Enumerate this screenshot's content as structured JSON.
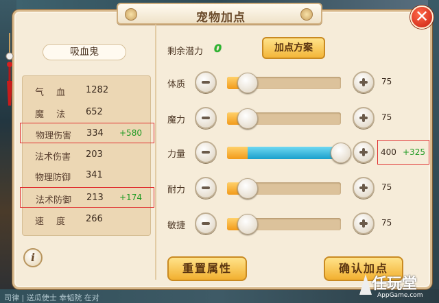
{
  "window": {
    "title": "宠物加点",
    "close_label": "✕"
  },
  "pet": {
    "name": "吸血鬼"
  },
  "stats": [
    {
      "label": "气血",
      "value": "1282",
      "bonus": "",
      "spread": true,
      "highlight": false
    },
    {
      "label": "魔法",
      "value": "652",
      "bonus": "",
      "spread": true,
      "highlight": false
    },
    {
      "label": "物理伤害",
      "value": "334",
      "bonus": "+580",
      "spread": false,
      "highlight": true
    },
    {
      "label": "法术伤害",
      "value": "203",
      "bonus": "",
      "spread": false,
      "highlight": false
    },
    {
      "label": "物理防御",
      "value": "341",
      "bonus": "",
      "spread": false,
      "highlight": false
    },
    {
      "label": "法术防御",
      "value": "213",
      "bonus": "+174",
      "spread": false,
      "highlight": true
    },
    {
      "label": "速度",
      "value": "266",
      "bonus": "",
      "spread": true,
      "highlight": false
    }
  ],
  "potential": {
    "label": "剩余潜力",
    "value": "0"
  },
  "plan_button": "加点方案",
  "attributes": [
    {
      "name": "体质",
      "value": "75",
      "extra": "",
      "fill": 0.0
    },
    {
      "name": "魔力",
      "value": "75",
      "extra": "",
      "fill": 0.0
    },
    {
      "name": "力量",
      "value": "400",
      "extra": "+325",
      "fill": 1.0
    },
    {
      "name": "耐力",
      "value": "75",
      "extra": "",
      "fill": 0.0
    },
    {
      "name": "敏捷",
      "value": "75",
      "extra": "",
      "fill": 0.0
    }
  ],
  "buttons": {
    "reset": "重置属性",
    "confirm": "确认加点"
  },
  "info_icon": "i",
  "background_text": "司律 | 送瓜使士  幸韬院  在对",
  "watermark": {
    "main": "任玩堂",
    "sub": "AppGame.com"
  },
  "colors": {
    "accent_green": "#1f9a22",
    "highlight_red": "#e03030",
    "button_gold": "#f2b030",
    "slider_blue": "#1aa0cc"
  }
}
